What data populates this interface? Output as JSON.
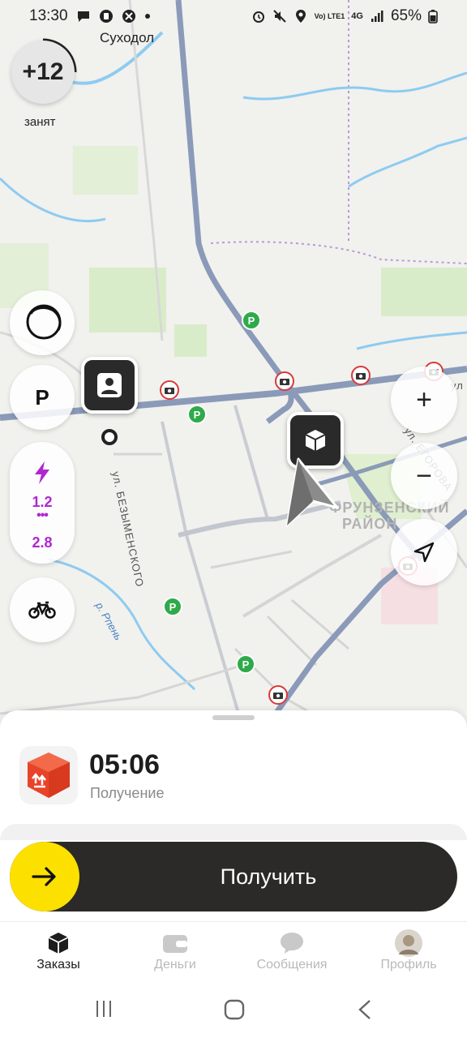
{
  "status": {
    "time": "13:30",
    "battery": "65%",
    "network": "4G",
    "carrier_tag": "Vo) LTE1"
  },
  "map": {
    "place_label": "Суходол",
    "street_left": "ул. БЕЗЫМЕНСКОГО",
    "street_right": "ул. ЕГОРОВА",
    "street_top": "ул",
    "district": [
      "ФРУНЗЕНСКИЙ",
      "РАЙОН"
    ],
    "river": "р. Рпень"
  },
  "widgets": {
    "score": "+12",
    "busy_label": "занят",
    "parking": "P",
    "coeff_top": "1.2",
    "coeff_dots": "•••",
    "coeff_bottom": "2.8",
    "zoom_in": "+",
    "zoom_out": "−"
  },
  "order": {
    "timer": "05:06",
    "stage": "Получение",
    "action": "Получить"
  },
  "tabs": [
    {
      "label": "Заказы",
      "icon": "orders-box-icon",
      "active": true
    },
    {
      "label": "Деньги",
      "icon": "wallet-icon",
      "active": false
    },
    {
      "label": "Сообщения",
      "icon": "chat-bubble-icon",
      "active": false
    },
    {
      "label": "Профиль",
      "icon": "avatar",
      "active": false
    }
  ],
  "colors": {
    "accent": "#fce000",
    "swipe_bg": "#2b2a28",
    "coeff": "#b026d0",
    "gas": "#2faa4a",
    "camera": "#d73a3a"
  }
}
